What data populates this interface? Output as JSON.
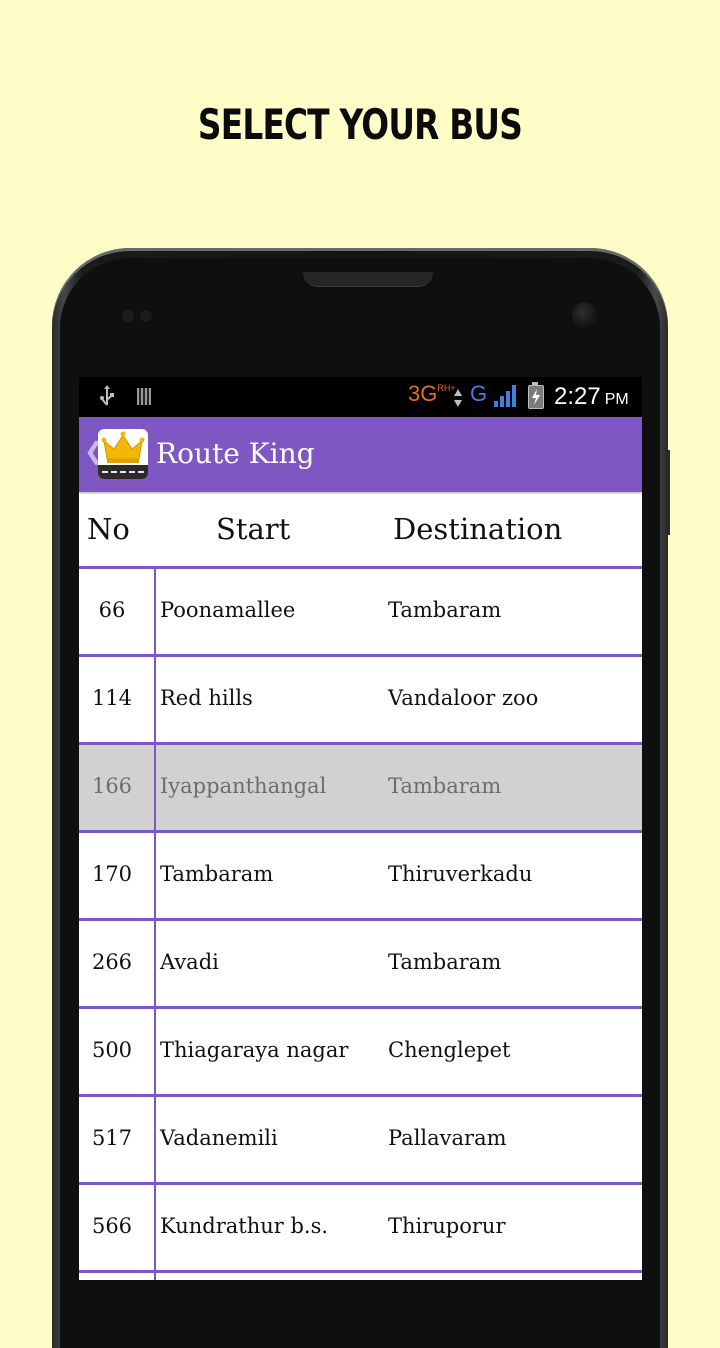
{
  "headline": "SELECT YOUR BUS",
  "status_bar": {
    "network": "3G",
    "network_sup": "RH+",
    "signal_label": "G",
    "time": "2:27",
    "ampm": "PM",
    "usb_icon": "usb-icon",
    "sd_icon": "sd-card-icon",
    "battery_icon": "battery-charging-icon"
  },
  "action_bar": {
    "back_icon": "chevron-left-icon",
    "app_icon": "crown-road-icon",
    "title": "Route King",
    "color": "#7e57c2"
  },
  "table": {
    "headers": {
      "no": "No",
      "start": "Start",
      "destination": "Destination"
    },
    "rows": [
      {
        "no": "66",
        "start": "Poonamallee",
        "destination": "Tambaram",
        "selected": false
      },
      {
        "no": "114",
        "start": "Red hills",
        "destination": "Vandaloor zoo",
        "selected": false
      },
      {
        "no": "166",
        "start": "Iyappanthangal",
        "destination": "Tambaram",
        "selected": true
      },
      {
        "no": "170",
        "start": "Tambaram",
        "destination": "Thiruverkadu",
        "selected": false
      },
      {
        "no": "266",
        "start": "Avadi",
        "destination": "Tambaram",
        "selected": false
      },
      {
        "no": "500",
        "start": "Thiagaraya nagar",
        "destination": "Chenglepet",
        "selected": false
      },
      {
        "no": "517",
        "start": "Vadanemili",
        "destination": "Pallavaram",
        "selected": false
      },
      {
        "no": "566",
        "start": "Kundrathur b.s.",
        "destination": "Thiruporur",
        "selected": false
      }
    ]
  },
  "colors": {
    "background": "#fefdc7",
    "accent": "#7e57c2",
    "selected_row": "#d1d1d1",
    "network_orange": "#e36d1e",
    "signal_blue": "#3d7fe3"
  }
}
